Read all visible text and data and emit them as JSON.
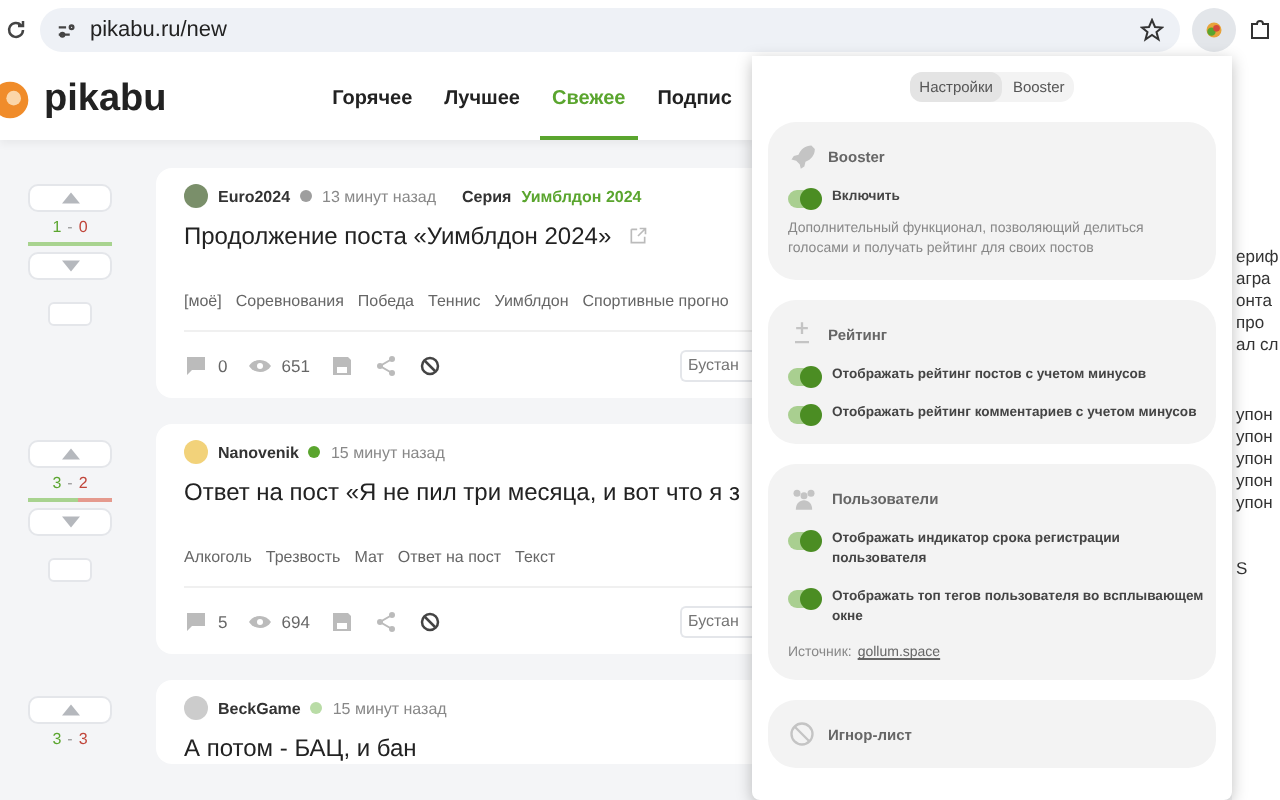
{
  "browser": {
    "url": "pikabu.ru/new"
  },
  "site": {
    "logo": "pikabu",
    "nav": [
      {
        "label": "Горячее",
        "selected": false
      },
      {
        "label": "Лучшее",
        "selected": false
      },
      {
        "label": "Свежее",
        "selected": true
      },
      {
        "label": "Подпис",
        "selected": false
      }
    ]
  },
  "posts": [
    {
      "pluses": "1",
      "separator": "-",
      "minuses": "0",
      "level": 1,
      "author": "Euro2024",
      "color": "#9e9e9e",
      "time": "13 минут назад",
      "series_label": "Серия",
      "series": "Уимблдон 2024",
      "title": "Продолжение поста «Уимблдон 2024»",
      "external": true,
      "tags": [
        "[моё]",
        "Соревнования",
        "Победа",
        "Теннис",
        "Уимблдон",
        "Спортивные прогно"
      ],
      "comments": "0",
      "views": "651",
      "booster_placeholder": "Бустан"
    },
    {
      "pluses": "3",
      "separator": "-",
      "minuses": "2",
      "level": 0.6,
      "author": "Nanovenik",
      "color": "#5aa52e",
      "time": "15 минут назад",
      "title": "Ответ на пост «Я не пил три месяца, и вот что я з",
      "tags": [
        "Алкоголь",
        "Трезвость",
        "Мат",
        "Ответ на пост",
        "Текст"
      ],
      "comments": "5",
      "views": "694",
      "booster_placeholder": "Бустан"
    },
    {
      "pluses": "3",
      "separator": "-",
      "minuses": "3",
      "author": "BeckGame",
      "color": "#b9dca6",
      "time": "15 минут назад",
      "title": "А потом - БАЦ, и бан"
    }
  ],
  "side_text": [
    "ериф",
    "агра",
    "онта",
    "про",
    "ал сл",
    "упон",
    "упон",
    "упон",
    "упон",
    "упон",
    "S"
  ],
  "popup": {
    "tabs": [
      {
        "label": "Настройки",
        "selected": true
      },
      {
        "label": "Booster",
        "selected": false
      }
    ],
    "sections": [
      {
        "kind": "rocket",
        "title": "Booster",
        "toggles": [
          {
            "label": "Включить",
            "on": true
          }
        ],
        "description": "Дополнительный функционал, позволяющий делиться голосами и получать рейтинг для своих постов"
      },
      {
        "kind": "rating",
        "title": "Рейтинг",
        "toggles": [
          {
            "label": "Отображать рейтинг постов с учетом минусов",
            "on": true
          },
          {
            "label": "Отображать рейтинг комментариев с учетом минусов",
            "on": true
          }
        ]
      },
      {
        "kind": "users",
        "title": "Пользователи",
        "toggles": [
          {
            "label": "Отображать индикатор срока регистрации пользователя",
            "on": true
          },
          {
            "label": "Отображать топ тегов пользователя во всплывающем окне",
            "on": true
          }
        ],
        "source_label": "Источник:",
        "source_link": "gollum.space"
      },
      {
        "kind": "ignore",
        "title": "Игнор-лист"
      }
    ]
  }
}
